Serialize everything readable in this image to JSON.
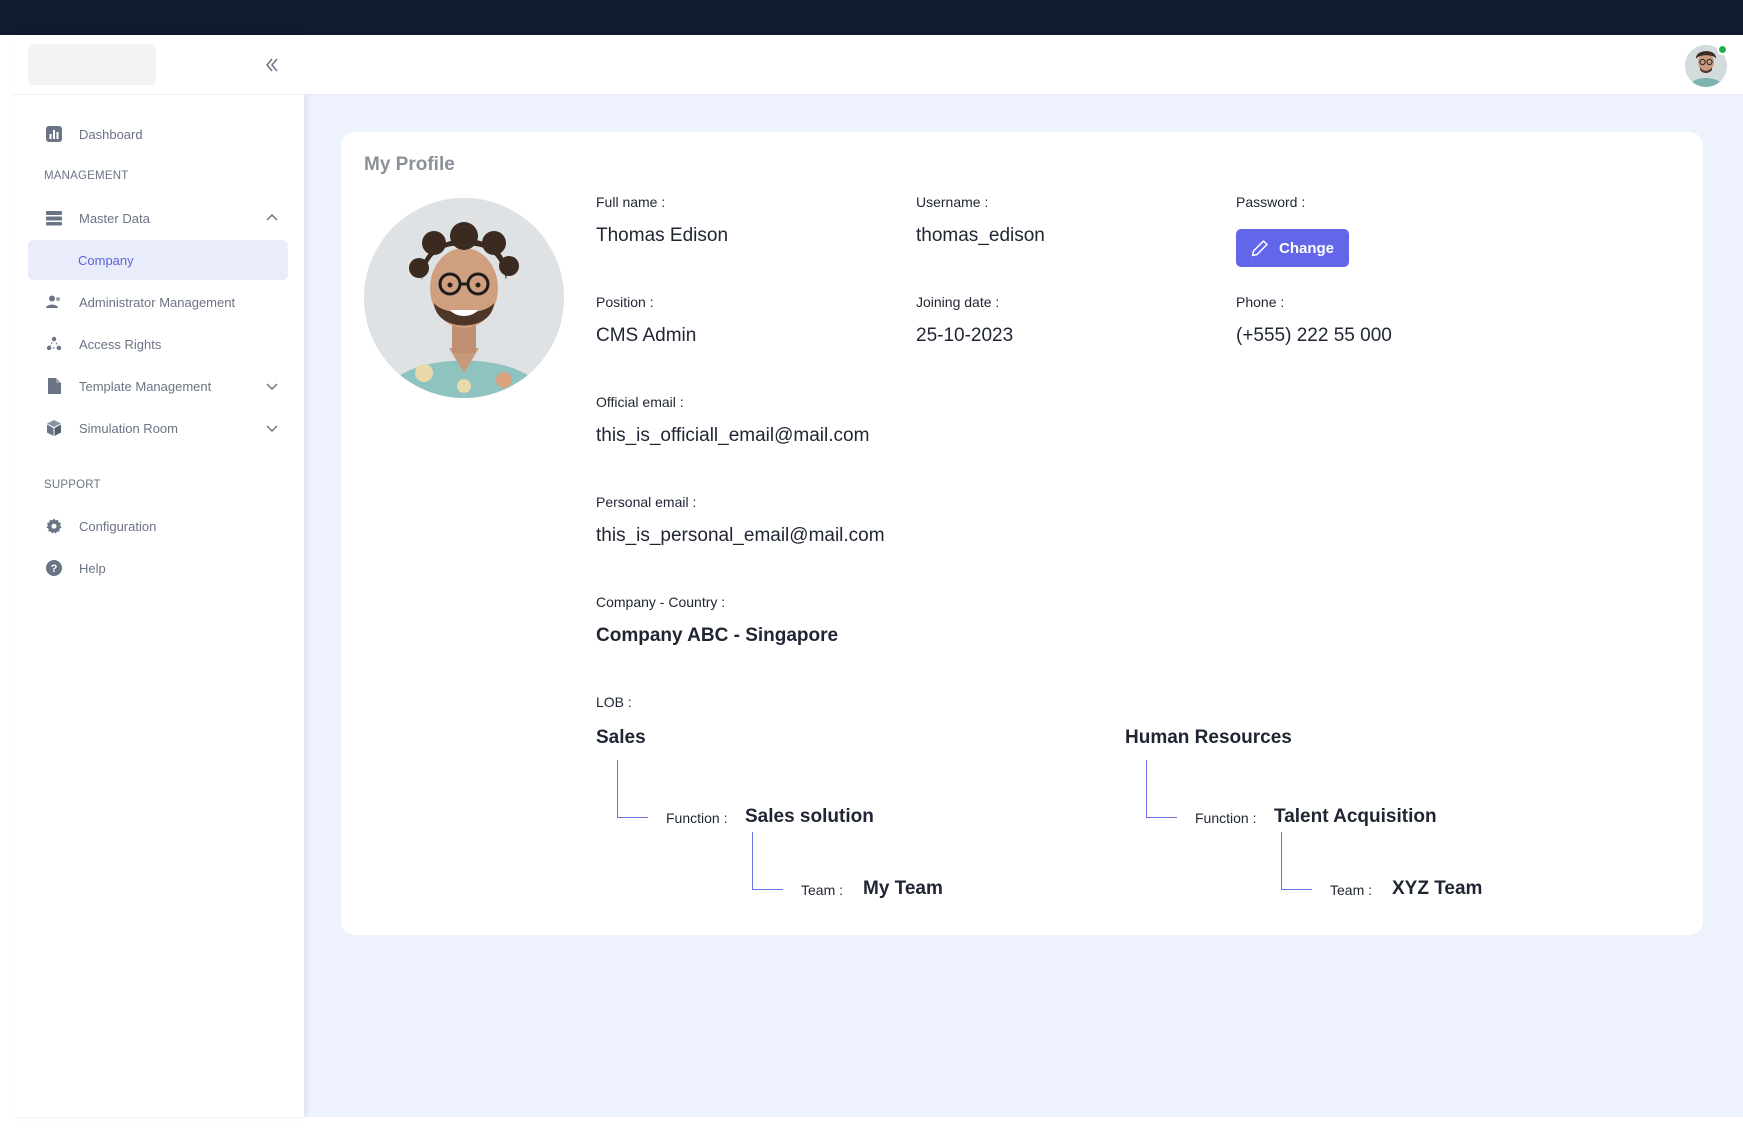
{
  "sidebar": {
    "collapse_icon": "double-chevron-left-icon",
    "items": [
      {
        "label": "Dashboard",
        "icon": "chart-bar-icon"
      },
      {
        "label": "Master Data",
        "icon": "database-icon"
      },
      {
        "label": "Company"
      },
      {
        "label": "Administrator Management",
        "icon": "users-icon"
      },
      {
        "label": "Access Rights",
        "icon": "shared-network-icon"
      },
      {
        "label": "Template Management",
        "icon": "file-icon"
      },
      {
        "label": "Simulation Room",
        "icon": "cube-icon"
      },
      {
        "label": "Configuration",
        "icon": "gear-icon"
      },
      {
        "label": "Help",
        "icon": "question-circle-icon"
      }
    ],
    "sections": {
      "management": "MANAGEMENT",
      "support": "SUPPORT"
    }
  },
  "header": {
    "avatar_status": "online",
    "status_color": "#22b24c"
  },
  "profile": {
    "title": "My Profile",
    "full_name_label": "Full name :",
    "full_name": "Thomas Edison",
    "username_label": "Username :",
    "username": "thomas_edison",
    "password_label": "Password :",
    "change_label": "Change",
    "position_label": "Position :",
    "position": "CMS Admin",
    "joining_label": "Joining date :",
    "joining_date": "25-10-2023",
    "phone_label": "Phone :",
    "phone": "(+555) 222 55 000",
    "official_email_label": "Official email :",
    "official_email": "this_is_officiall_email@mail.com",
    "personal_email_label": "Personal email :",
    "personal_email": "this_is_personal_email@mail.com",
    "company_country_label": "Company - Country :",
    "company_country": "Company ABC - Singapore",
    "lob_label": "LOB :",
    "lobs": [
      {
        "name": "Sales",
        "function_label": "Function :",
        "function": "Sales solution",
        "team_label": "Team :",
        "team": "My Team"
      },
      {
        "name": "Human Resources",
        "function_label": "Function :",
        "function": "Talent Acquisition",
        "team_label": "Team :",
        "team": "XYZ Team"
      }
    ]
  },
  "colors": {
    "accent": "#6366e8",
    "top_bar": "#121a2e",
    "background": "#eef2fc",
    "active_nav_bg": "#e9ecfb"
  }
}
